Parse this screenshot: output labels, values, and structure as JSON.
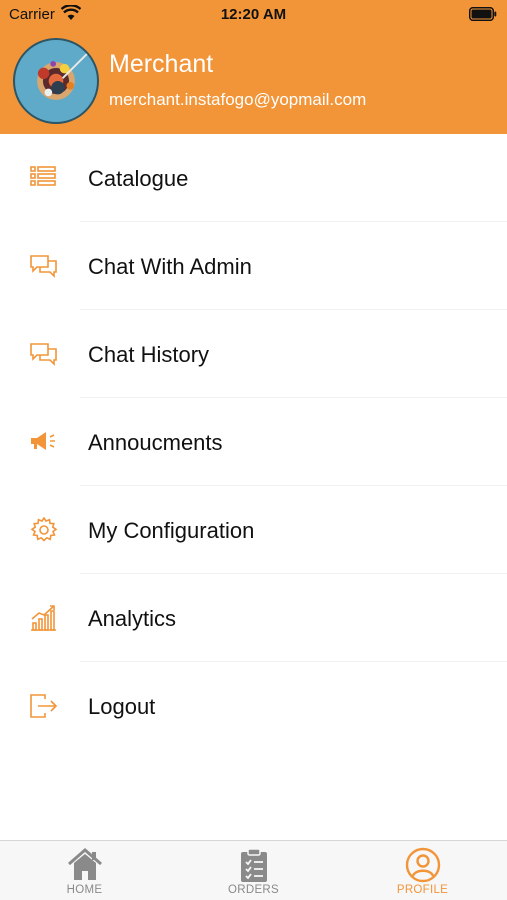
{
  "status_bar": {
    "carrier": "Carrier",
    "time": "12:20 AM"
  },
  "profile": {
    "name": "Merchant",
    "email": "merchant.instafogo@yopmail.com"
  },
  "colors": {
    "accent": "#F29539",
    "tab_inactive": "#8a8a8a"
  },
  "menu": [
    {
      "label": "Catalogue",
      "icon": "list-icon"
    },
    {
      "label": "Chat With Admin",
      "icon": "chat-icon"
    },
    {
      "label": "Chat History",
      "icon": "chat-icon"
    },
    {
      "label": "Annoucments",
      "icon": "megaphone-icon"
    },
    {
      "label": "My Configuration",
      "icon": "gear-icon"
    },
    {
      "label": "Analytics",
      "icon": "chart-icon"
    },
    {
      "label": "Logout",
      "icon": "logout-icon"
    }
  ],
  "tabs": [
    {
      "label": "HOME",
      "icon": "home-icon",
      "active": false
    },
    {
      "label": "ORDERS",
      "icon": "clipboard-icon",
      "active": false
    },
    {
      "label": "PROFILE",
      "icon": "profile-icon",
      "active": true
    }
  ]
}
